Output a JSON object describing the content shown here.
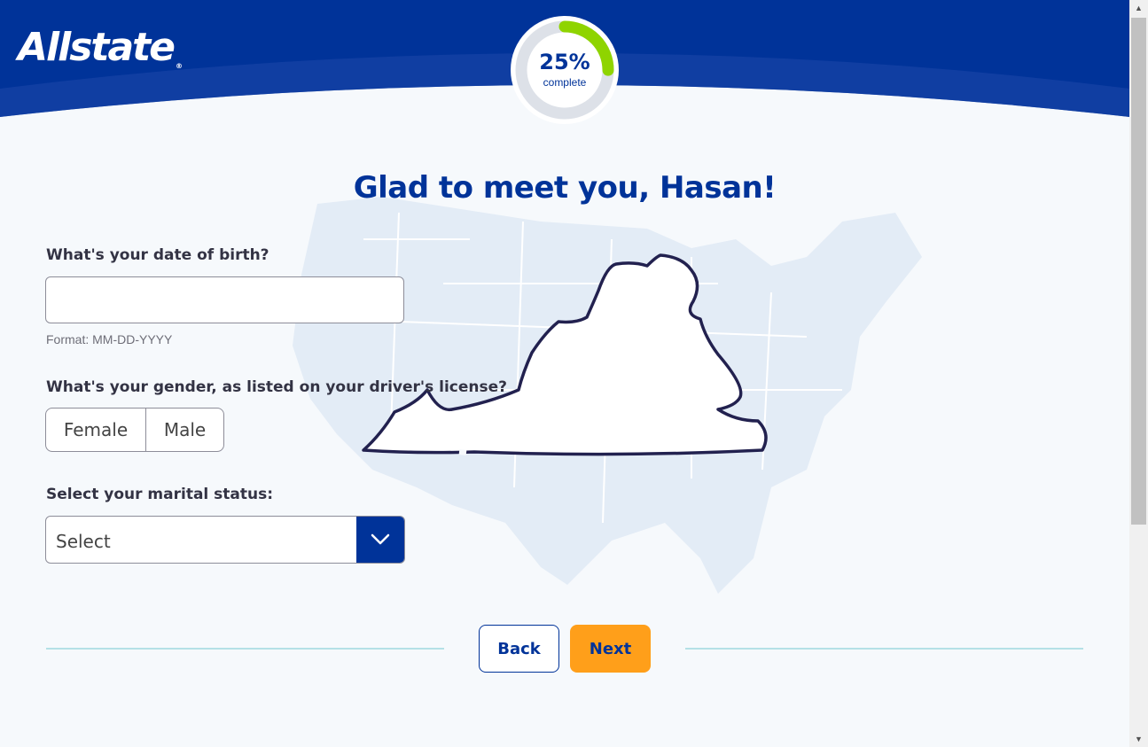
{
  "brand": {
    "name": "Allstate",
    "mark": "®",
    "primary_color": "#003399",
    "accent_color": "#ff9f1a",
    "progress_color": "#8fd400"
  },
  "progress": {
    "percent_text": "25%",
    "label": "complete",
    "fraction": 0.25
  },
  "heading": "Glad to meet you, Hasan!",
  "dob": {
    "label": "What's your date of birth?",
    "value": "",
    "hint": "Format: MM-DD-YYYY"
  },
  "gender": {
    "label": "What's your gender, as listed on your driver's license?",
    "options": [
      "Female",
      "Male"
    ]
  },
  "marital": {
    "label": "Select your marital status:",
    "value": "Select"
  },
  "actions": {
    "back": "Back",
    "next": "Next"
  },
  "icons": {
    "dropdown": "chevron-down-icon",
    "scroll_up": "arrow-up-icon",
    "scroll_down": "arrow-down-icon"
  }
}
